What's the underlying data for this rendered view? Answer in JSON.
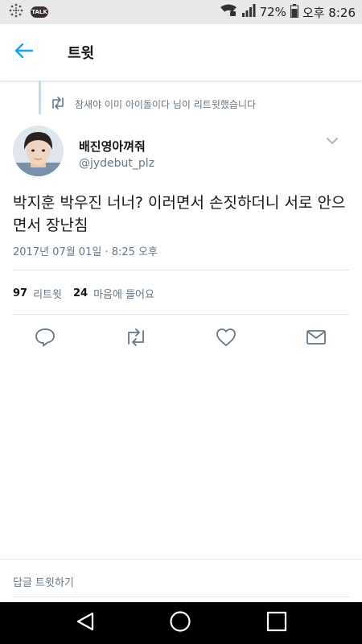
{
  "status_bar": {
    "battery": "72%",
    "time": "오후 8:26",
    "talk_badge": "TALK"
  },
  "app_bar": {
    "title": "트윗",
    "back_icon": "arrow-left-icon"
  },
  "retweet_context": {
    "text": "참새야 이미 아이돌이다 님이 리트윗했습니다"
  },
  "tweet": {
    "display_name": "배진영아껴줘",
    "handle": "@jydebut_plz",
    "text": "박지훈 박우진 너너? 이러면서 손짓하더니 서로 안으면서 장난침",
    "timestamp": "2017년 07월 01일 · 8:25 오후",
    "retweet_count": "97",
    "retweet_label": "리트윗",
    "like_count": "24",
    "like_label": "마음에 들어요"
  },
  "actions": [
    "reply-icon",
    "retweet-icon",
    "heart-icon",
    "message-icon"
  ],
  "reply_bar": {
    "placeholder": "답글 트윗하기"
  },
  "colors": {
    "accent": "#1da1f2",
    "secondary_text": "#657786",
    "divider": "#e1e8ed"
  }
}
